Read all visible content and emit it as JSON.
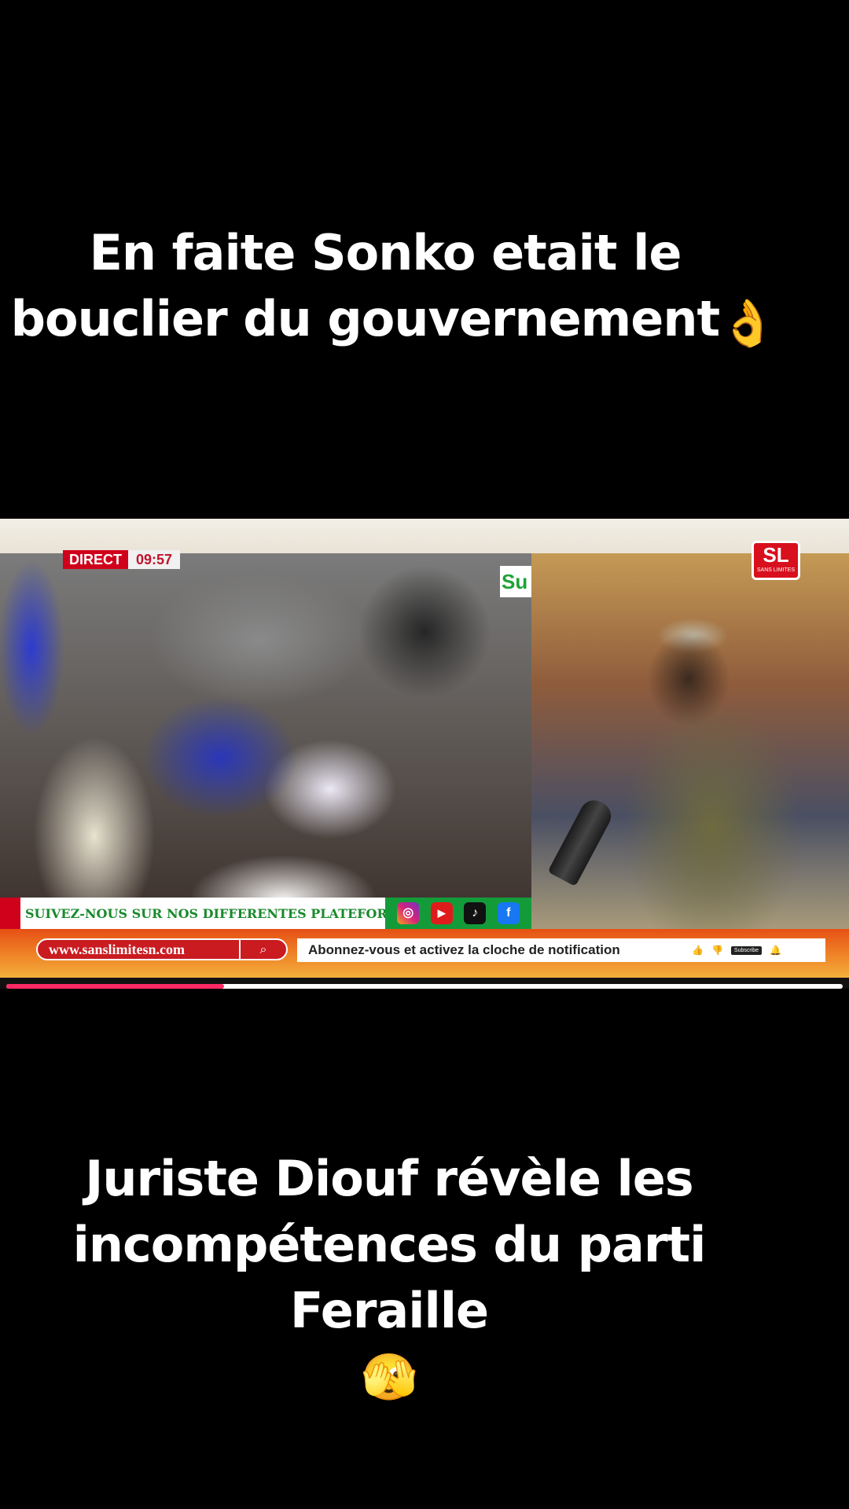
{
  "captions": {
    "top_line1": "En faite Sonko etait le",
    "top_line2": "bouclier du gouvernement",
    "top_emoji": "👌",
    "bottom_line1": "Juriste Diouf révèle les",
    "bottom_line2": "incompétences du parti",
    "bottom_line3": "Feraille",
    "bottom_emoji": "🫣"
  },
  "video": {
    "direct_label": "DIRECT",
    "time": "09:57",
    "channel_logo_left": "Su",
    "channel_logo_right": "SL",
    "channel_logo_right_sub": "SANS LIMITES",
    "follow_text": "SUIVEZ-NOUS SUR NOS DIFFERENTES PLATEFORMES",
    "social_icons": [
      "instagram-icon",
      "youtube-icon",
      "tiktok-icon",
      "facebook-icon"
    ],
    "website": "www.sanslimitesn.com",
    "subscribe_text": "Abonnez-vous et activez la cloche de notification",
    "subscribe_button": "Subscribe",
    "progress_fraction": 0.26
  },
  "colors": {
    "background": "#000000",
    "caption_text": "#ffffff",
    "direct_red": "#d0021b",
    "follow_green": "#198a2c",
    "ticker_orange": "#e65014",
    "progress_pink": "#ff2a64"
  }
}
